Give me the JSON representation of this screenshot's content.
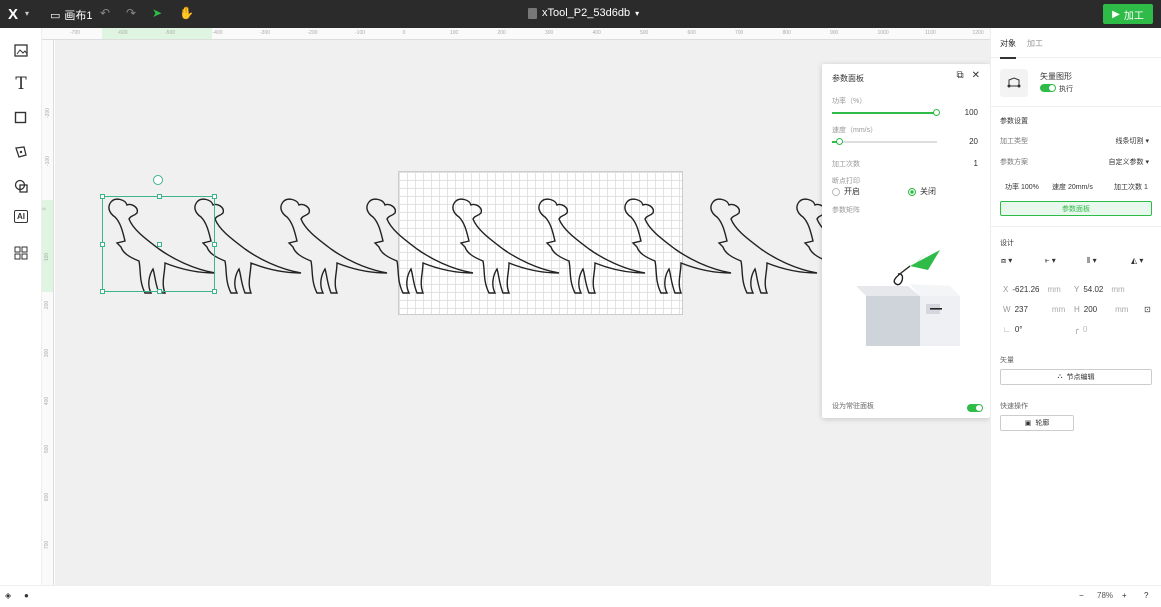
{
  "topbar": {
    "logo": "X",
    "doc_name": "画布1",
    "file_title": "xTool_P2_53d6db",
    "process_button": "加工"
  },
  "rulers": {
    "h_ticks": [
      "-700",
      "-600",
      "-500",
      "-400",
      "-300",
      "-200",
      "-100",
      "0",
      "100",
      "200",
      "300",
      "400",
      "500",
      "600",
      "700",
      "800",
      "900",
      "1000",
      "1100",
      "1200"
    ],
    "v_ticks": [
      "-200",
      "-100",
      "0",
      "100",
      "200",
      "300",
      "400",
      "500",
      "600",
      "700"
    ]
  },
  "param_panel": {
    "title": "参数面板",
    "power_label": "功率（%）",
    "power_value": "100",
    "power_level": 1.0,
    "speed_label": "速度（mm/s）",
    "speed_value": "20",
    "speed_level": 0.08,
    "passes_label": "加工次数",
    "passes_value": "1",
    "breakpoint_label": "断点打印",
    "radio_on": "开启",
    "radio_off": "关闭",
    "matrix_label": "参数矩阵",
    "set_default_label": "设为常驻面板"
  },
  "right_panel": {
    "tabs": [
      "对象",
      "加工"
    ],
    "object_type": "矢量图形",
    "execute_label": "执行",
    "params_section": "参数设置",
    "process_type_label": "加工类型",
    "process_type_value": "线条切割",
    "scheme_label": "参数方案",
    "scheme_value": "自定义参数",
    "chips": [
      "功率 100%",
      "速度 20mm/s",
      "加工次数 1"
    ],
    "param_panel_button": "参数面板",
    "design_section": "设计",
    "x_label": "X",
    "x_value": "-621.26",
    "x_unit": "mm",
    "y_label": "Y",
    "y_value": "54.02",
    "y_unit": "mm",
    "w_label": "W",
    "w_value": "237",
    "w_unit": "mm",
    "h_label": "H",
    "h_value": "200",
    "h_unit": "mm",
    "angle_value": "0°",
    "corner_value": "0",
    "vector_section": "矢量",
    "node_edit_button": "节点编辑",
    "quick_section": "快速操作",
    "outline_button": "轮廓"
  },
  "bottombar": {
    "zoom": "78%"
  }
}
